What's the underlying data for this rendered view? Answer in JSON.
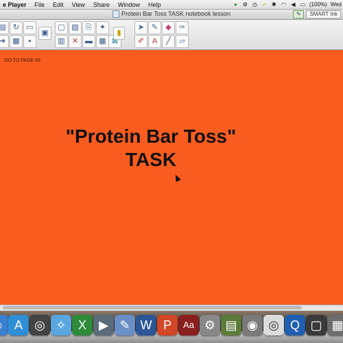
{
  "menubar": {
    "app_name": "e Player",
    "items": [
      "File",
      "Edit",
      "View",
      "Share",
      "Window",
      "Help"
    ],
    "battery": "(100%)",
    "clock": "Wed"
  },
  "window": {
    "title": "Protein Bar Toss TASK notebook lesson",
    "smart_ink_label": "SMART Ink"
  },
  "canvas": {
    "page_note": "GO TO PAGE 69",
    "title_line1": "\"Protein Bar Toss\"",
    "title_line2": "TASK",
    "background": "#f95c1f"
  },
  "toolbar_icons": [
    "folder",
    "redo",
    "folder-open",
    "new-page",
    "delete-page",
    "image",
    "fullscreen",
    "screen-shade",
    "table",
    "save",
    "select",
    "pen",
    "eraser",
    "line",
    "text",
    "shape",
    "properties"
  ],
  "dock_icons": [
    "finder",
    "app-store",
    "dashboard",
    "safari",
    "excel",
    "facetime",
    "smart-notebook",
    "word",
    "powerpoint",
    "dictionary",
    "system-preferences",
    "archive",
    "photo-booth",
    "dvd",
    "quicktime",
    "preview"
  ]
}
